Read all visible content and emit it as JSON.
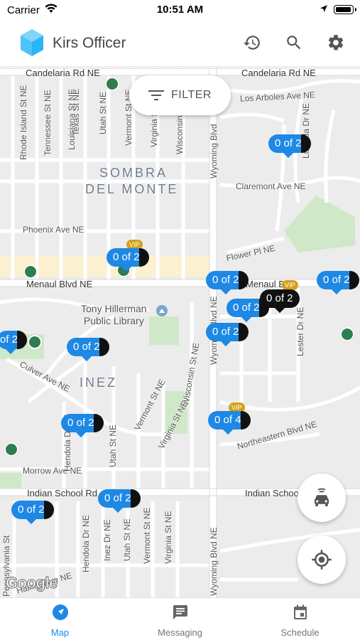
{
  "status_bar": {
    "carrier": "Carrier",
    "time": "10:51 AM"
  },
  "app_bar": {
    "title": "Kirs Officer",
    "actions": [
      {
        "icon": "history-icon"
      },
      {
        "icon": "search-icon"
      },
      {
        "icon": "gear-icon"
      }
    ]
  },
  "map": {
    "filter_label": "FILTER",
    "labels": {
      "candelaria_left": "Candelaria Rd NE",
      "candelaria_right": "Candelaria Rd NE",
      "los_arboles": "Los Arboles Ave NE",
      "claremont": "Claremont Ave NE",
      "phoenix": "Phoenix Ave NE",
      "flower": "Flower Pl NE",
      "menaul_left": "Menaul Blvd NE",
      "menaul_right": "Menaul B",
      "culver": "Culver Ave NE",
      "northeastern": "Northeastern Blvd NE",
      "morrow": "Morrow Ave NE",
      "indian_school_left": "Indian School Rd",
      "indian_school_right": "Indian Schoo",
      "haines": "Haines Ave NE",
      "rhode_island": "Rhode Island St NE",
      "tennessee": "Tennessee St NE",
      "louisiana": "Louisiana St NE",
      "texas": "Texas St NE",
      "utah_top": "Utah St NE",
      "vermont_top": "Vermont St NE",
      "virginia_top": "Virginia St NE",
      "wisconsin_top": "Wisconsin",
      "wyoming_top": "Wyoming Blvd",
      "wyoming_mid": "Wyoming Blvd NE",
      "wyoming_bottom": "Wyoming Blvd NE",
      "lester": "Lester Dr NE",
      "lucinda": "Lucinda Dr NE",
      "wisconsin_mid": "Wisconsin St NE",
      "vermont_mid": "Vermont St NE",
      "virginia_mid": "Virginia St NE",
      "utah_mid": "Utah St NE",
      "hendola_mid": "Hendola Dr NE",
      "hendola_bottom": "Hendola Dr NE",
      "inez_dr": "Inez Dr NE",
      "utah_bottom": "Utah St NE",
      "vermont_bottom": "Vermont St NE",
      "virginia_bottom": "Virginia St NE",
      "pennsylvania": "Pennsylvania St",
      "area_sombra": "SOMBRA",
      "area_del_monte": "DEL MONTE",
      "area_inez": "INEZ",
      "poi_library_line1": "Tony Hillerman",
      "poi_library_line2": "Public Library"
    },
    "pins": [
      {
        "text": "0 of 2"
      },
      {
        "text": "0 of 2",
        "vip": "VIP"
      },
      {
        "text": "0 of 2"
      },
      {
        "text": "0 of 2"
      },
      {
        "text": "0 of 2",
        "vip": "VIP"
      },
      {
        "text": "0 of 2"
      },
      {
        "text": "0 of 2"
      },
      {
        "text": "of 2"
      },
      {
        "text": "0 of 2"
      },
      {
        "text": "0 of 2"
      },
      {
        "text": "0 of 4",
        "vip": "VIP"
      },
      {
        "text": "0 of 2"
      },
      {
        "text": "0 of 2"
      }
    ],
    "attribution": "Google"
  },
  "fabs": [
    {
      "icon": "car-icon"
    },
    {
      "icon": "my-location-icon"
    }
  ],
  "tabs": [
    {
      "label": "Map",
      "icon": "navigation-arrow-icon",
      "active": true
    },
    {
      "label": "Messaging",
      "icon": "message-icon",
      "active": false
    },
    {
      "label": "Schedule",
      "icon": "calendar-icon",
      "active": false
    }
  ],
  "colors": {
    "accent": "#1e88e5",
    "pin_dark": "#111111",
    "vip": "#d4a11a",
    "park": "#c8e6c9",
    "dot": "#2e7d4f"
  }
}
